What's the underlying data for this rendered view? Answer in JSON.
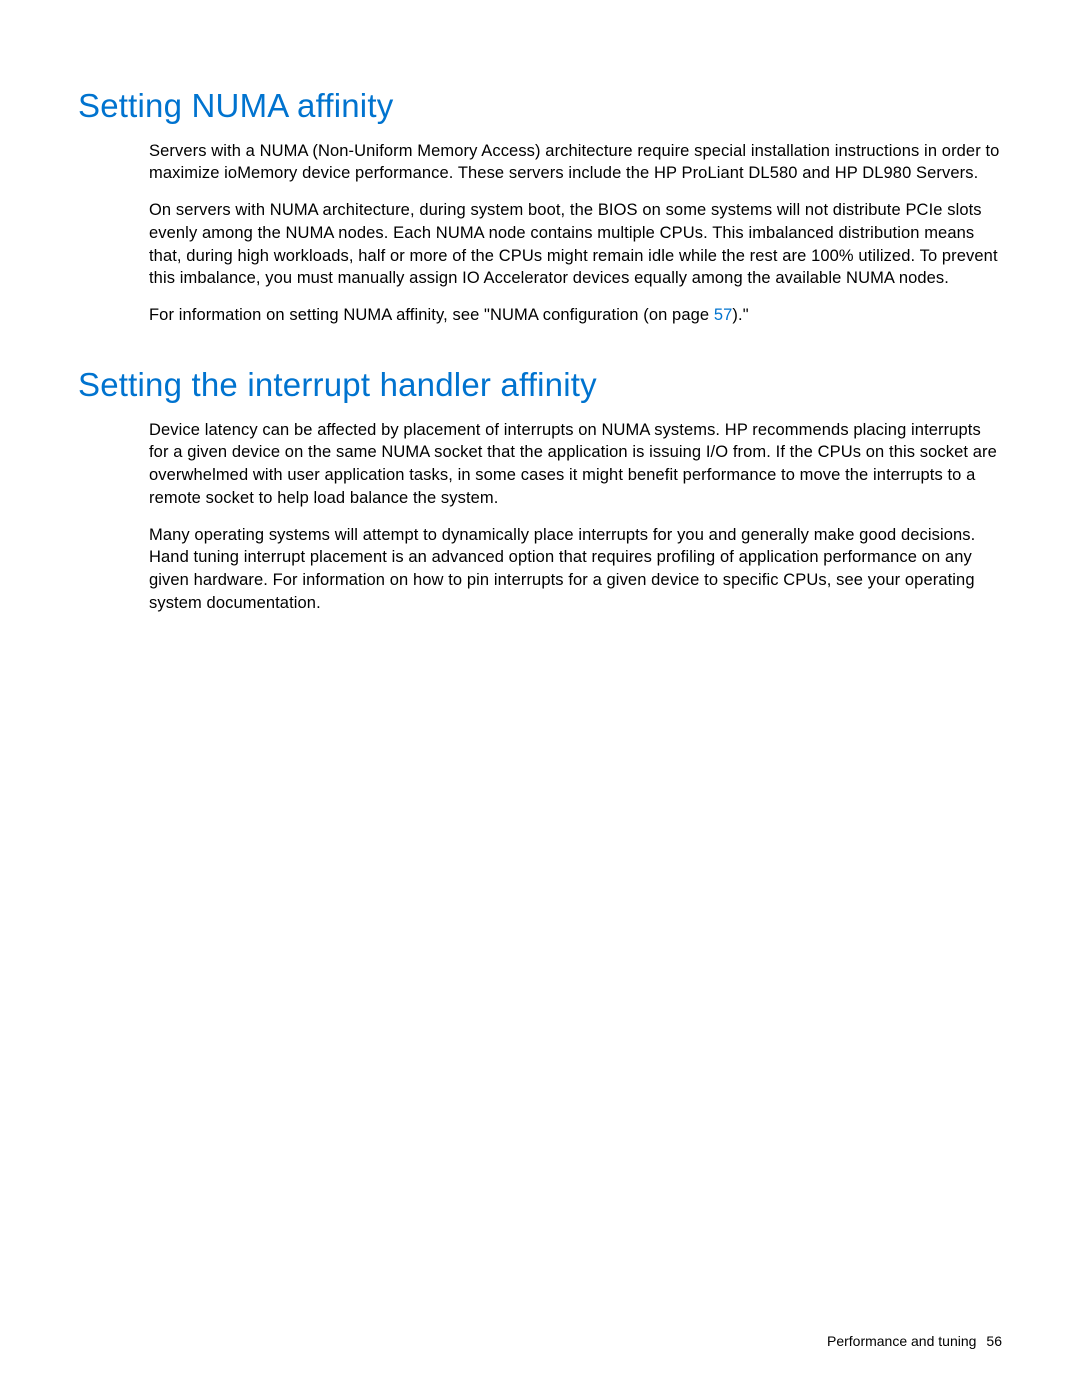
{
  "section1": {
    "heading": "Setting NUMA affinity",
    "p1": "Servers with a NUMA (Non-Uniform Memory Access) architecture require special installation instructions in order to maximize ioMemory device performance. These servers include the HP ProLiant DL580 and HP DL980 Servers.",
    "p2": "On servers with NUMA architecture, during system boot, the BIOS on some systems will not distribute PCIe slots evenly among the NUMA nodes. Each NUMA node contains multiple CPUs. This imbalanced distribution means that, during high workloads, half or more of the CPUs might remain idle while the rest are 100% utilized. To prevent this imbalance, you must manually assign IO Accelerator devices equally among the available NUMA nodes.",
    "p3_pre": "For information on setting NUMA affinity, see \"NUMA configuration (on page ",
    "p3_link": "57",
    "p3_post": ").\""
  },
  "section2": {
    "heading": "Setting the interrupt handler affinity",
    "p1": "Device latency can be affected by placement of interrupts on NUMA systems. HP recommends placing interrupts for a given device on the same NUMA socket that the application is issuing I/O from. If the CPUs on this socket are overwhelmed with user application tasks, in some cases it might benefit performance to move the interrupts to a remote socket to help load balance the system.",
    "p2": "Many operating systems will attempt to dynamically place interrupts for you and generally make good decisions. Hand tuning interrupt placement is an advanced option that requires profiling of application performance on any given hardware. For information on how to pin interrupts for a given device to specific CPUs, see your operating system documentation."
  },
  "footer": {
    "title": "Performance and tuning",
    "page": "56"
  }
}
